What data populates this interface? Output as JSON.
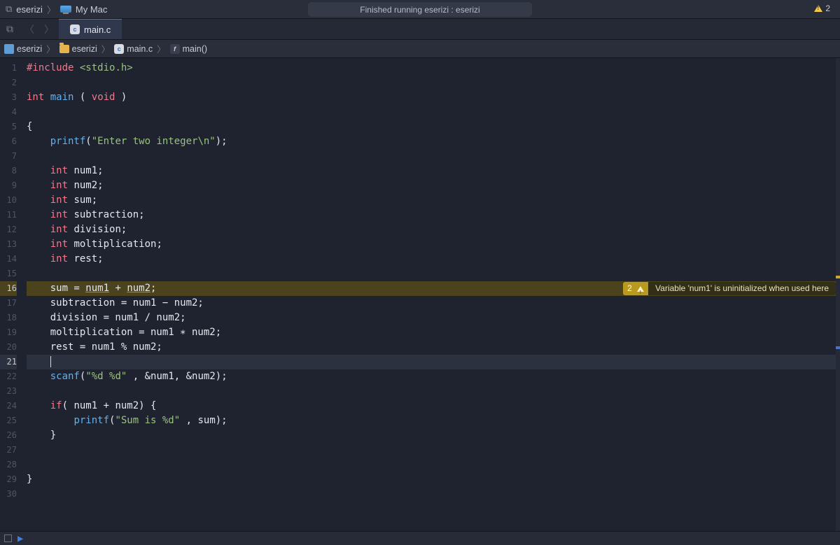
{
  "toolbar": {
    "scheme": "eserizi",
    "destination": "My Mac",
    "status": "Finished running eserizi : eserizi",
    "warning_count": "2"
  },
  "tabs": {
    "active_file": "main.c"
  },
  "breadcrumbs": {
    "project": "eserizi",
    "folder": "eserizi",
    "file": "main.c",
    "symbol": "main()"
  },
  "code_lines": [
    {
      "n": "1",
      "html": "<span class='kw'>#include</span> <span class='str'>&lt;stdio.h&gt;</span>"
    },
    {
      "n": "2",
      "html": ""
    },
    {
      "n": "3",
      "html": "<span class='typ'>int</span> <span class='inc'>main</span> <span class='pp'>(</span> <span class='typ'>void</span> <span class='pp'>)</span>"
    },
    {
      "n": "4",
      "html": ""
    },
    {
      "n": "5",
      "html": "<span class='pp'>{</span>"
    },
    {
      "n": "6",
      "html": "    <span class='fn'>printf</span><span class='pp'>(</span><span class='str'>\"Enter two integer\\n\"</span><span class='pp'>);</span>"
    },
    {
      "n": "7",
      "html": ""
    },
    {
      "n": "8",
      "html": "    <span class='typ'>int</span> <span class='id'>num1;</span>"
    },
    {
      "n": "9",
      "html": "    <span class='typ'>int</span> <span class='id'>num2;</span>"
    },
    {
      "n": "10",
      "html": "    <span class='typ'>int</span> <span class='id'>sum;</span>"
    },
    {
      "n": "11",
      "html": "    <span class='typ'>int</span> <span class='id'>subtraction;</span>"
    },
    {
      "n": "12",
      "html": "    <span class='typ'>int</span> <span class='id'>division;</span>"
    },
    {
      "n": "13",
      "html": "    <span class='typ'>int</span> <span class='id'>moltiplication;</span>"
    },
    {
      "n": "14",
      "html": "    <span class='typ'>int</span> <span class='id'>rest;</span>"
    },
    {
      "n": "15",
      "html": ""
    },
    {
      "n": "16",
      "html": "    <span class='id'>sum = </span><span class='id und'>num1</span><span class='id'> + </span><span class='id und'>num2</span><span class='id'>;</span>",
      "warn": true
    },
    {
      "n": "17",
      "html": "    <span class='id'>subtraction = num1 − num2;</span>"
    },
    {
      "n": "18",
      "html": "    <span class='id'>division = num1 / num2;</span>"
    },
    {
      "n": "19",
      "html": "    <span class='id'>moltiplication = num1 ∗ num2;</span>"
    },
    {
      "n": "20",
      "html": "    <span class='id'>rest = num1 % num2;</span>"
    },
    {
      "n": "21",
      "html": "    <span class='cursor-caret'></span>",
      "cursor": true
    },
    {
      "n": "22",
      "html": "    <span class='fn'>scanf</span><span class='pp'>(</span><span class='str'>\"%d %d\"</span><span class='id'> , &amp;num1, &amp;num2</span><span class='pp'>);</span>"
    },
    {
      "n": "23",
      "html": ""
    },
    {
      "n": "24",
      "html": "    <span class='kw'>if</span><span class='pp'>(</span><span class='id'> num1 + num2</span><span class='pp'>) {</span>"
    },
    {
      "n": "25",
      "html": "        <span class='fn'>printf</span><span class='pp'>(</span><span class='str'>\"Sum is %d\"</span><span class='id'> , sum</span><span class='pp'>);</span>"
    },
    {
      "n": "26",
      "html": "    <span class='pp'>}</span>"
    },
    {
      "n": "27",
      "html": ""
    },
    {
      "n": "28",
      "html": ""
    },
    {
      "n": "29",
      "html": "<span class='pp'>}</span>"
    },
    {
      "n": "30",
      "html": ""
    }
  ],
  "inline_warning": {
    "count": "2",
    "message": "Variable 'num1' is uninitialized when used here"
  }
}
